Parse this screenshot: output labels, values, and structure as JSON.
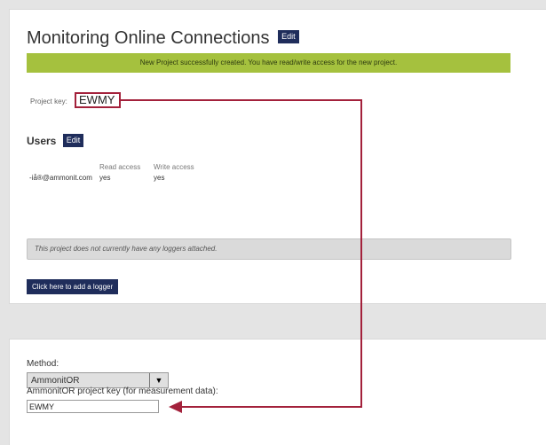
{
  "header": {
    "title": "Monitoring Online Connections",
    "edit_label": "Edit"
  },
  "banner": {
    "message": "New Project successfully created. You have read/write access for the new project."
  },
  "project": {
    "key_label": "Project key:",
    "key_value": "EWMY"
  },
  "users": {
    "heading": "Users",
    "edit_label": "Edit",
    "columns": [
      "Read access",
      "Write access"
    ],
    "rows": [
      {
        "email": "-iå®@ammonit.com",
        "read": "yes",
        "write": "yes"
      }
    ]
  },
  "loggers": {
    "notice": "This project does not currently have any loggers attached.",
    "add_button_label": "Click here to add a logger"
  },
  "measurement": {
    "method_label": "Method:",
    "method_value": "AmmonitOR",
    "project_key_label": "AmmonitOR project key (for measurement data):",
    "project_key_value": "EWMY"
  },
  "colors": {
    "accent_dark": "#1f2d5b",
    "banner_green": "#a5c13e",
    "highlight_red": "#a3213b"
  },
  "icons": {
    "dropdown": "chevron-down-icon",
    "connector": "arrow-icon"
  }
}
